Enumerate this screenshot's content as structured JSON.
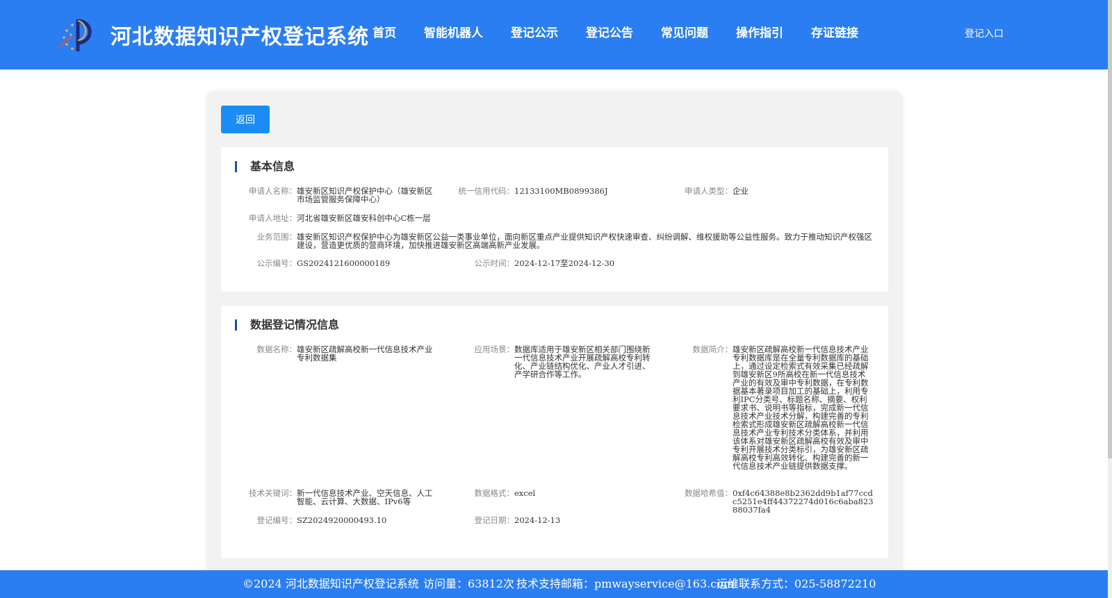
{
  "header": {
    "title": "河北数据知识产权登记系统",
    "nav": [
      "首页",
      "智能机器人",
      "登记公示",
      "登记公告",
      "常见问题",
      "操作指引",
      "存证链接"
    ],
    "login": "登记入口"
  },
  "back_label": "返回",
  "basic": {
    "title": "基本信息",
    "applicant_name": {
      "label": "申请人名称：",
      "value": "雄安新区知识产权保护中心（雄安新区市场监管服务保障中心）"
    },
    "credit_code": {
      "label": "统一信用代码：",
      "value": "12133100MB0899386J"
    },
    "applicant_type": {
      "label": "申请人类型：",
      "value": "企业"
    },
    "address": {
      "label": "申请人地址：",
      "value": "河北省雄安新区雄安科创中心C栋一层"
    },
    "business_scope": {
      "label": "业务范围：",
      "value": "雄安新区知识产权保护中心为雄安新区公益一类事业单位，面向新区重点产业提供知识产权快速审查、纠纷调解、维权援助等公益性服务。致力于推动知识产权强区建设，营造更优质的营商环境，加快推进雄安新区高端高新产业发展。"
    },
    "notice_no": {
      "label": "公示编号：",
      "value": "GS2024121600000189"
    },
    "notice_time": {
      "label": "公示时间：",
      "value": "2024-12-17至2024-12-30"
    }
  },
  "registration": {
    "title": "数据登记情况信息",
    "data_name": {
      "label": "数据名称：",
      "value": "雄安新区疏解高校新一代信息技术产业专利数据集"
    },
    "scenario": {
      "label": "应用场景：",
      "value": "数据库适用于雄安新区相关部门围绕新一代信息技术产业开展疏解高校专利转化、产业链结构优化、产业人才引进、产学研合作等工作。"
    },
    "summary": {
      "label": "数据简介：",
      "value": "雄安新区疏解高校新一代信息技术产业专利数据库是在全量专利数据库的基础上，通过设定检索式有效采集已经疏解到雄安新区9所高校在新一代信息技术产业的有效及审中专利数据，在专利数据基本著录项目加工的基础上，利用专利IPC分类号、标题名称、摘要、权利要求书、说明书等指标，完成新一代信息技术产业技术分解，构建完善的专利检索式形成雄安新区疏解高校新一代信息技术产业专利技术分类体系，并利用该体系对雄安新区疏解高校有效及审中专利开展技术分类标引，为雄安新区疏解高校专利高效转化、构建完善的新一代信息技术产业链提供数据支撑。"
    },
    "keywords": {
      "label": "技术关键词：",
      "value": "新一代信息技术产业、空天信息、人工智能、云计算、大数据、IPv6等"
    },
    "format": {
      "label": "数据格式：",
      "value": "excel"
    },
    "hash": {
      "label": "数据哈希值：",
      "value": "0xf4c64388e8b2362dd9b1af77ccdc5251e4ff44372274d016c6aba82388037fa4"
    },
    "reg_no": {
      "label": "登记编号：",
      "value": "SZ2024920000493.10"
    },
    "reg_date": {
      "label": "登记日期：",
      "value": "2024-12-13"
    }
  },
  "footer": {
    "copyright": "©2024 河北数据知识产权登记系统",
    "visits": "访问量：63812次",
    "email": "技术支持邮箱：pmwayservice@163.com",
    "phone": "运维联系方式：025-58872210"
  },
  "colors": {
    "primary": "#2b7ef1",
    "button": "#1c8cf5",
    "section_bar": "#1f4fa8"
  }
}
